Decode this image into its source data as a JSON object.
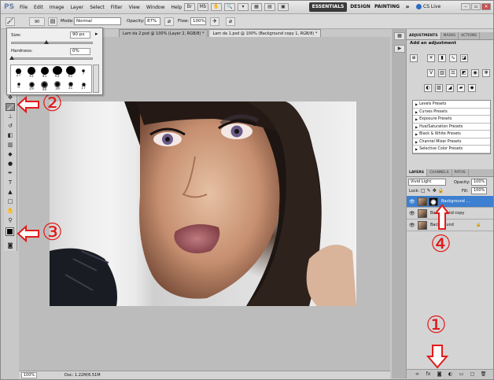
{
  "app": {
    "logo": "PS"
  },
  "menu": [
    "File",
    "Edit",
    "Image",
    "Layer",
    "Select",
    "Filter",
    "View",
    "Window",
    "Help"
  ],
  "workspaces": {
    "essentials": "ESSENTIALS",
    "design": "DESIGN",
    "painting": "PAINTING",
    "more": "»"
  },
  "cslive": "CS Live",
  "options_bar": {
    "brush_size": "90",
    "mode_label": "Mode:",
    "mode_value": "Normal",
    "opacity_label": "Opacity:",
    "opacity_value": "87%",
    "flow_label": "Flow:",
    "flow_value": "100%"
  },
  "brush_popup": {
    "size_label": "Size:",
    "size_value": "90 px",
    "hardness_label": "Hardness:",
    "hardness_value": "0%",
    "size_level": 0.42,
    "hardness_level": 0.0,
    "presets": [
      {
        "label": "27",
        "d": 7,
        "soft": false
      },
      {
        "label": "41",
        "d": 10,
        "soft": false
      },
      {
        "label": "41",
        "d": 10,
        "soft": false
      },
      {
        "label": "61",
        "d": 12,
        "soft": false
      },
      {
        "label": "61",
        "d": 12,
        "soft": false
      },
      {
        "label": "7",
        "d": 4,
        "soft": true
      },
      {
        "label": "9",
        "d": 4,
        "soft": true
      },
      {
        "label": "29",
        "d": 7,
        "soft": true
      },
      {
        "label": "46",
        "d": 9,
        "soft": true
      },
      {
        "label": "39",
        "d": 8,
        "soft": true
      },
      {
        "label": "31",
        "d": 6,
        "soft": true
      },
      {
        "label": "17",
        "d": 5,
        "soft": true
      }
    ]
  },
  "doc_tabs": [
    {
      "label": "Lam da 2.psd @ 100% (Layer 2, RGB/8) *",
      "active": false
    },
    {
      "label": "Lam da 1.psd @ 100% (Background copy 1, RGB/8) *",
      "active": true
    }
  ],
  "status": {
    "zoom": "100%",
    "doc": "Doc: 1.22M/6.51M"
  },
  "adjustments": {
    "tabs": [
      "ADJUSTMENTS",
      "MASKS",
      "ACTIONS"
    ],
    "title": "Add an adjustment",
    "presets": [
      "Levels Presets",
      "Curves Presets",
      "Exposure Presets",
      "Hue/Saturation Presets",
      "Black & White Presets",
      "Channel Mixer Presets",
      "Selective Color Presets"
    ]
  },
  "layers": {
    "tabs": [
      "LAYERS",
      "CHANNELS",
      "PATHS"
    ],
    "blend_mode": "Vivid Light",
    "opacity_label": "Opacity:",
    "opacity_value": "100%",
    "lock_label": "Lock:",
    "fill_label": "Fill:",
    "fill_value": "100%",
    "items": [
      {
        "name": "Background ...",
        "selected": true
      },
      {
        "name": "Background copy",
        "selected": false
      },
      {
        "name": "Background",
        "selected": false
      }
    ]
  },
  "annotations": [
    "①",
    "②",
    "③",
    "④"
  ],
  "colors": {
    "annotation": "#e21b1b",
    "selection": "#3d7fd0",
    "essentials_bg": "#3a3a3a"
  }
}
